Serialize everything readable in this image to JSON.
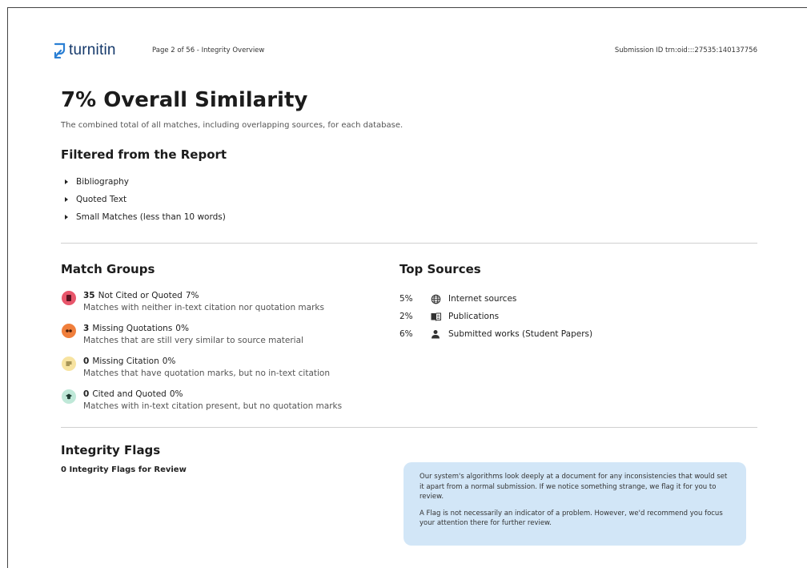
{
  "header": {
    "logo_text": "turnitin",
    "page_info": "Page 2 of 56 - Integrity Overview",
    "submission_id": "Submission ID  trn:oid:::27535:140137756"
  },
  "overview": {
    "title": "7%  Overall Similarity",
    "subtitle": "The combined total of all matches, including overlapping sources, for each database."
  },
  "filtered": {
    "heading": "Filtered from the Report",
    "items": [
      "Bibliography",
      "Quoted Text",
      "Small Matches (less than 10 words)"
    ]
  },
  "match_groups": {
    "heading": "Match Groups",
    "items": [
      {
        "count": "35",
        "label": "Not Cited or Quoted",
        "percent": "7%",
        "description": "Matches with neither in-text citation nor quotation marks",
        "icon": "document-icon",
        "color": "#e8566b"
      },
      {
        "count": "3",
        "label": "Missing Quotations",
        "percent": "0%",
        "description": "Matches that are still very similar to source material",
        "icon": "quote-icon",
        "color": "#f07f3c"
      },
      {
        "count": "0",
        "label": "Missing Citation",
        "percent": "0%",
        "description": "Matches that have quotation marks, but no in-text citation",
        "icon": "lines-icon",
        "color": "#f7e3a0"
      },
      {
        "count": "0",
        "label": "Cited and Quoted",
        "percent": "0%",
        "description": "Matches with in-text citation present, but no quotation marks",
        "icon": "graduation-cap-icon",
        "color": "#bfe8d8"
      }
    ]
  },
  "top_sources": {
    "heading": "Top Sources",
    "items": [
      {
        "percent": "5%",
        "label": "Internet sources",
        "icon": "globe-icon"
      },
      {
        "percent": "2%",
        "label": "Publications",
        "icon": "book-icon"
      },
      {
        "percent": "6%",
        "label": "Submitted works (Student Papers)",
        "icon": "person-icon"
      }
    ]
  },
  "integrity_flags": {
    "heading": "Integrity Flags",
    "count_text": "0 Integrity Flags for Review",
    "info_paragraph_1": "Our system's algorithms look deeply at a document for any inconsistencies that would set it apart from a normal submission. If we notice something strange, we flag it for you to review.",
    "info_paragraph_2": "A Flag is not necessarily an indicator of a problem. However, we'd recommend you focus your attention there for further review."
  },
  "colors": {
    "brand": "#15396b",
    "logo_accent": "#2a7fd4",
    "info_box": "#d2e6f7"
  }
}
